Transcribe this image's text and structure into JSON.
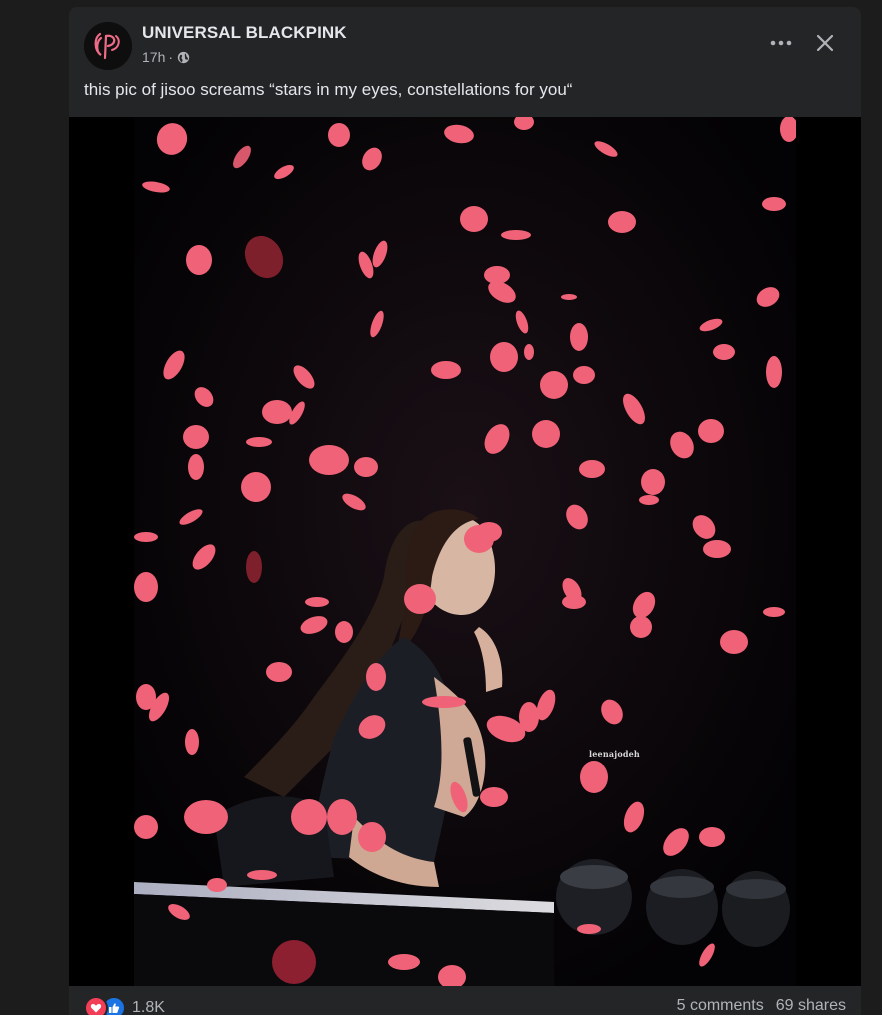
{
  "post": {
    "page_name": "UNIVERSAL BLACKPINK",
    "time": "17h",
    "separator": "·",
    "caption": "this pic of jisoo screams “stars in my eyes, constellations for you“"
  },
  "photo": {
    "watermark": "leenajodeh",
    "petal_color": "#f06277"
  },
  "footer": {
    "reaction_count": "1.8K",
    "comments": "5 comments",
    "shares": "69 shares"
  },
  "icons": {
    "avatar": "blackpink-logo",
    "privacy": "globe-icon",
    "more": "more-options-icon",
    "close": "close-icon",
    "reactions": [
      "love-icon",
      "like-icon"
    ]
  },
  "colors": {
    "card_background": "#242526",
    "page_background": "#1c1c1d",
    "primary_text": "#e4e6eb",
    "secondary_text": "#b0b3b8",
    "love": "#f33e58",
    "like": "#1b74e4"
  }
}
